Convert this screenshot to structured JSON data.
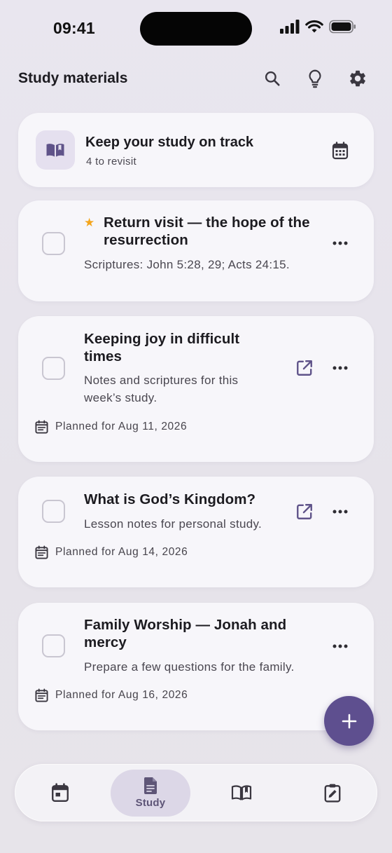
{
  "status_bar": {
    "time": "09:41"
  },
  "header": {
    "title": "Study materials"
  },
  "top_actions": [
    "search-icon",
    "lightbulb-icon",
    "gear-icon"
  ],
  "hero": {
    "title": "Keep your study on track",
    "subtitle": "4 to revisit",
    "icon": "open-book-icon",
    "action_icon": "calendar-icon"
  },
  "items": [
    {
      "title_line1": "Return visit — the hope of the",
      "title_line2": "resurrection",
      "description": "Scriptures: John 5:28, 29; Acts 24:15.",
      "starred": true
    },
    {
      "title_line1": "Keeping joy in difficult",
      "title_line2": "times",
      "description_line1": "Notes and scriptures for this",
      "description_line2": "week’s study.",
      "planned": "Planned for Aug 11, 2026"
    },
    {
      "title_line1": "What is God’s Kingdom?",
      "description": "Lesson notes for personal study.",
      "planned": "Planned for Aug 14, 2026"
    },
    {
      "title_line1": "Family Worship — Jonah and",
      "title_line2": "mercy",
      "description": "Prepare a few questions for the family.",
      "planned": "Planned for Aug 16, 2026"
    }
  ],
  "fab_icon": "plus-icon",
  "bottom_nav": {
    "items": [
      {
        "icon": "calendar-icon",
        "label": ""
      },
      {
        "icon": "document-icon",
        "label": "Study",
        "active": true
      },
      {
        "icon": "open-book-icon",
        "label": ""
      },
      {
        "icon": "clipboard-edit-icon",
        "label": ""
      }
    ]
  },
  "colors": {
    "accent": "#5e4f8f",
    "star": "#f4a51c",
    "card_bg": "#f7f6fa",
    "icon": "#3a3740",
    "accent_icon": "#5f5389"
  }
}
